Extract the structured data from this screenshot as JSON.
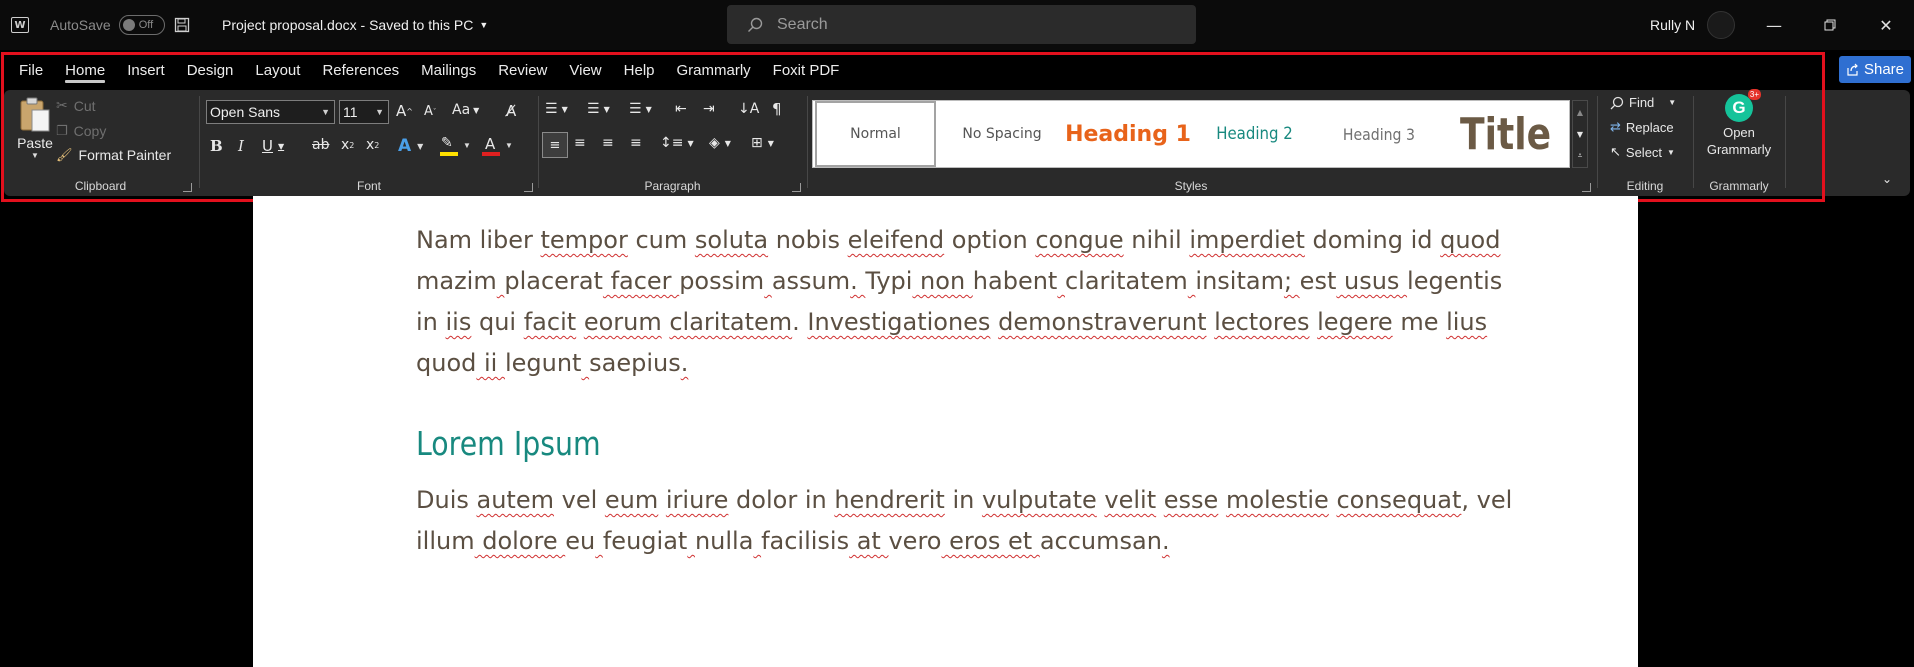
{
  "titlebar": {
    "autosave_label": "AutoSave",
    "autosave_state": "Off",
    "doc_title": "Project proposal.docx - Saved to this PC",
    "search_placeholder": "Search",
    "user_name": "Rully N"
  },
  "tabs": [
    "File",
    "Home",
    "Insert",
    "Design",
    "Layout",
    "References",
    "Mailings",
    "Review",
    "View",
    "Help",
    "Grammarly",
    "Foxit PDF"
  ],
  "active_tab": "Home",
  "share_label": "Share",
  "ribbon": {
    "clipboard": {
      "paste": "Paste",
      "cut": "Cut",
      "copy": "Copy",
      "format_painter": "Format Painter",
      "label": "Clipboard"
    },
    "font": {
      "family": "Open Sans",
      "size": "11",
      "label": "Font"
    },
    "paragraph": {
      "label": "Paragraph"
    },
    "styles": {
      "items": [
        "Normal",
        "No Spacing",
        "Heading 1",
        "Heading 2",
        "Heading 3",
        "Title"
      ],
      "colors": {
        "heading1": "#e8631a",
        "heading2": "#18897f",
        "heading3": "#707070",
        "title": "#6b5a45"
      },
      "label": "Styles"
    },
    "editing": {
      "find": "Find",
      "replace": "Replace",
      "select": "Select",
      "label": "Editing"
    },
    "grammarly": {
      "open": "Open",
      "grammarly": "Grammarly",
      "badge": "3+",
      "label": "Grammarly"
    }
  },
  "document": {
    "paragraph1": [
      [
        "Nam liber ",
        "tempor",
        " cum ",
        "soluta",
        " nobis ",
        "eleifend",
        " option ",
        "congue",
        " nihil ",
        "imperdiet",
        " doming id ",
        "quod"
      ],
      [
        "mazim",
        " ",
        "placerat",
        " facer ",
        "possim",
        " ",
        "assum",
        ". ",
        "Typi",
        " non ",
        "habent",
        " ",
        "claritatem",
        " ",
        "insitam",
        "; ",
        "est",
        " usus ",
        "legentis"
      ],
      [
        "in ",
        "iis",
        " qui ",
        "facit",
        " ",
        "eorum",
        " ",
        "claritatem",
        ". ",
        "Investigationes",
        " ",
        "demonstraverunt",
        " ",
        "lectores",
        " ",
        "legere",
        " me ",
        "lius"
      ],
      [
        "quod",
        " ii ",
        "legunt",
        " ",
        "saepius",
        "."
      ]
    ],
    "heading": "Lorem Ipsum",
    "paragraph2": [
      [
        "Duis ",
        "autem",
        " vel ",
        "eum",
        " ",
        "iriure",
        " dolor in ",
        "hendrerit",
        " in ",
        "vulputate",
        " ",
        "velit",
        " ",
        "esse",
        " ",
        "molestie",
        " ",
        "consequat",
        ", vel"
      ],
      [
        "illum",
        " dolore ",
        "eu",
        " ",
        "feugiat",
        " ",
        "nulla",
        " ",
        "facilisis",
        " at ",
        "vero",
        " eros et ",
        "accumsan",
        "."
      ]
    ]
  },
  "accent_colors": {
    "highlight_outline": "#e3101d",
    "share_button": "#2f6fd1"
  }
}
